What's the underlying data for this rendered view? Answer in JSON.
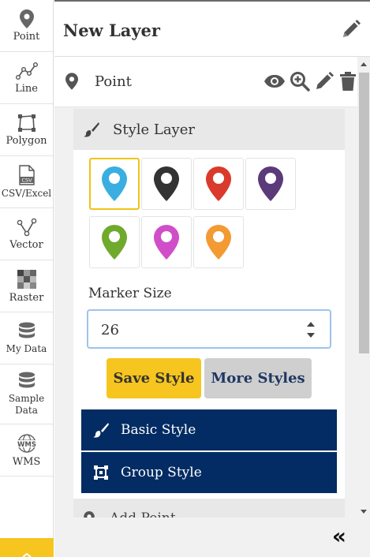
{
  "rail": {
    "items": [
      {
        "label": "Point",
        "icon": "point-icon"
      },
      {
        "label": "Line",
        "icon": "line-icon"
      },
      {
        "label": "Polygon",
        "icon": "polygon-icon"
      },
      {
        "label": "CSV/Excel",
        "icon": "csv-file-icon"
      },
      {
        "label": "Vector",
        "icon": "vector-icon"
      },
      {
        "label": "Raster",
        "icon": "raster-icon"
      },
      {
        "label": "My Data",
        "icon": "database-icon"
      },
      {
        "label": "Sample Data",
        "icon": "database-icon"
      },
      {
        "label": "WMS",
        "icon": "wms-globe-icon"
      }
    ],
    "csv_badge": "CSV",
    "wms_badge": "WMS",
    "active_accent": "#f6c51f"
  },
  "panel": {
    "title": "New Layer",
    "layer_name": "Point",
    "style_section_label": "Style Layer",
    "marker_colors": [
      "#3aaee0",
      "#333333",
      "#d93a2b",
      "#5b3a7a",
      "#6faa2c",
      "#d04ec8",
      "#f39a32"
    ],
    "selected_marker": 0,
    "marker_size_label": "Marker Size",
    "marker_size_value": "26",
    "save_style_label": "Save Style",
    "more_styles_label": "More Styles",
    "basic_style_label": "Basic Style",
    "group_style_label": "Group Style",
    "add_point_label": "Add Point",
    "collapse_label": "«"
  },
  "colors": {
    "accent_yellow": "#f6c51f",
    "navy": "#022c63",
    "panel_bg": "#f1f1f1"
  }
}
